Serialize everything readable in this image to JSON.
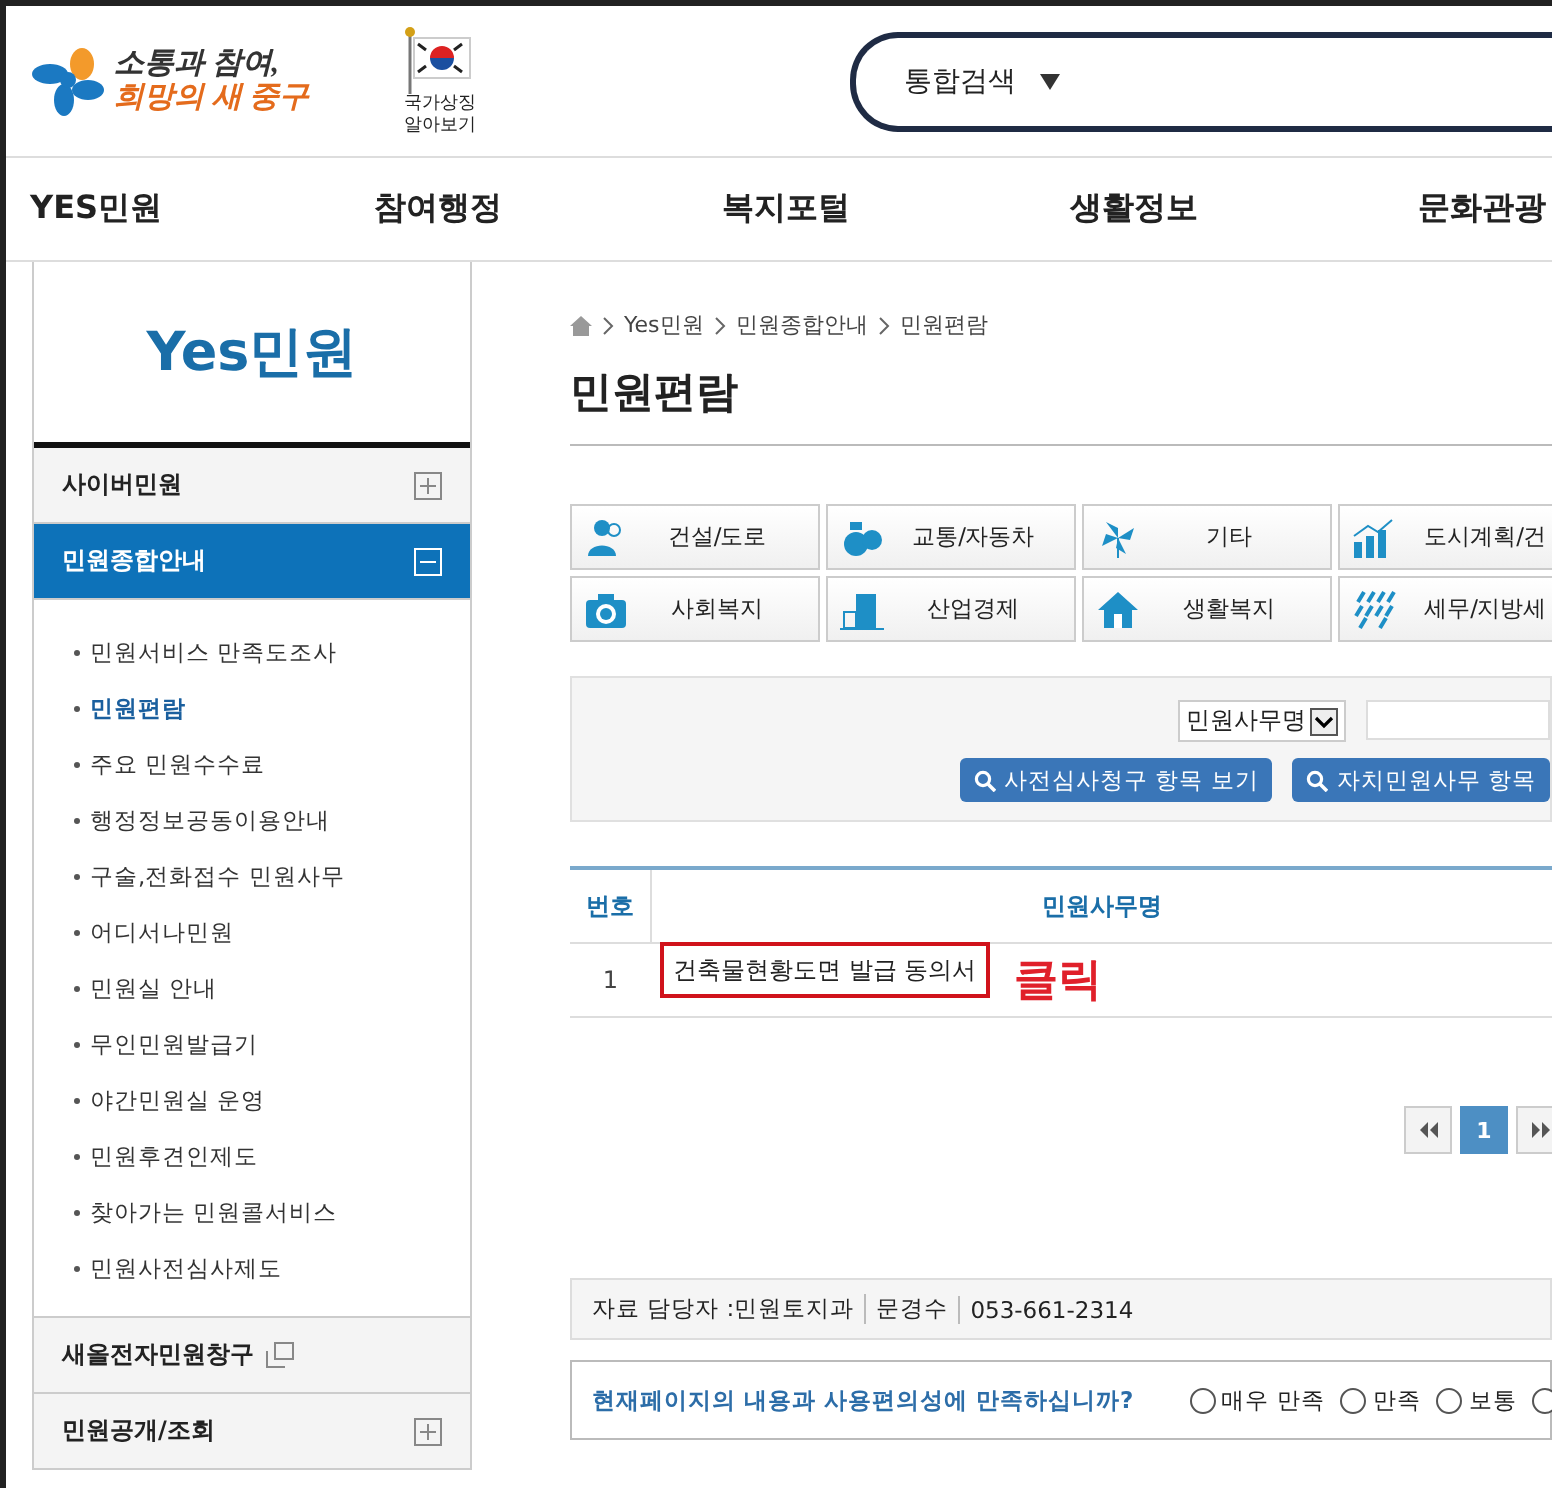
{
  "header": {
    "slogan_lines": [
      "소통과 참여,",
      "희망의 새 중구"
    ],
    "symbol_link": "국가상징 알아보기",
    "search": {
      "scope": "통합검색"
    }
  },
  "nav": [
    "YES민원",
    "참여행정",
    "복지포털",
    "생활정보",
    "문화관광"
  ],
  "sidebar": {
    "title": "Yes민원",
    "sections": [
      {
        "label": "사이버민원",
        "kind": "toggle",
        "expanded": false
      },
      {
        "label": "민원종합안내",
        "kind": "toggle",
        "expanded": true,
        "children": [
          {
            "label": "민원서비스 만족도조사",
            "selected": false
          },
          {
            "label": "민원편람",
            "selected": true
          },
          {
            "label": "주요 민원수수료",
            "selected": false
          },
          {
            "label": "행정정보공동이용안내",
            "selected": false
          },
          {
            "label": "구술,전화접수 민원사무",
            "selected": false
          },
          {
            "label": "어디서나민원",
            "selected": false
          },
          {
            "label": "민원실 안내",
            "selected": false
          },
          {
            "label": "무인민원발급기",
            "selected": false
          },
          {
            "label": "야간민원실 운영",
            "selected": false
          },
          {
            "label": "민원후견인제도",
            "selected": false
          },
          {
            "label": "찾아가는 민원콜서비스",
            "selected": false
          },
          {
            "label": "민원사전심사제도",
            "selected": false
          }
        ]
      },
      {
        "label": "새올전자민원창구",
        "kind": "external"
      },
      {
        "label": "민원공개/조회",
        "kind": "toggle",
        "expanded": false
      }
    ]
  },
  "breadcrumb": [
    "Yes민원",
    "민원종합안내",
    "민원편람"
  ],
  "page_title": "민원편람",
  "categories": [
    {
      "label": "건설/도로",
      "kind": "people"
    },
    {
      "label": "교통/자동차",
      "kind": "money"
    },
    {
      "label": "기타",
      "kind": "pinwheel"
    },
    {
      "label": "도시계획/건",
      "kind": "chart"
    },
    {
      "label": "사회복지",
      "kind": "camera"
    },
    {
      "label": "산업경제",
      "kind": "building"
    },
    {
      "label": "생활복지",
      "kind": "house"
    },
    {
      "label": "세무/지방세",
      "kind": "rain"
    }
  ],
  "filter": {
    "field_select": "민원사무명",
    "buttons": [
      "사전심사청구 항목 보기",
      "자치민원사무 항목"
    ]
  },
  "table": {
    "columns": [
      "번호",
      "민원사무명"
    ],
    "rows": [
      {
        "number": "1",
        "name": "건축물현황도면 발급 동의서",
        "highlighted": true
      }
    ]
  },
  "annotation": "클릭",
  "pagination": [
    {
      "label": "1",
      "selected": true
    }
  ],
  "contact": [
    "자료 담당자 :민원토지과",
    "문경수",
    "053-661-2314"
  ],
  "survey": {
    "question": "현재페이지의 내용과 사용편의성에 만족하십니까?",
    "options": [
      {
        "label": "매우 만족",
        "selected": false
      },
      {
        "label": "만족",
        "selected": false
      },
      {
        "label": "보통",
        "selected": false
      },
      {
        "selected": false
      }
    ]
  }
}
